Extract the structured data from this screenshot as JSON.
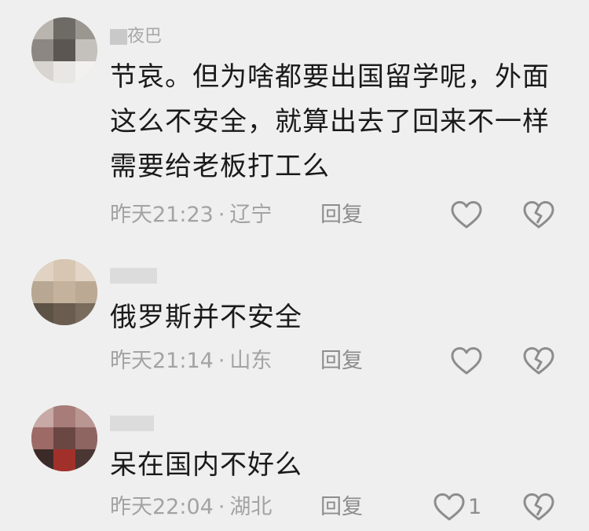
{
  "comments": [
    {
      "username": "夜巴",
      "text_lines": [
        "节哀。但为啥都要出国留学呢，外面",
        "这么不安全，就算出去了回来不一样",
        "需要给老板打工么"
      ],
      "time": "昨天21:23",
      "location": "辽宁",
      "reply_label": "回复",
      "like_count": "",
      "like_icon": "heart-outline-icon",
      "dislike_icon": "broken-heart-icon"
    },
    {
      "username": "",
      "text_lines": [
        "俄罗斯并不安全"
      ],
      "time": "昨天21:14",
      "location": "山东",
      "reply_label": "回复",
      "like_count": "",
      "like_icon": "heart-outline-icon",
      "dislike_icon": "broken-heart-icon"
    },
    {
      "username": "",
      "text_lines": [
        "呆在国内不好么"
      ],
      "time": "昨天22:04",
      "location": "湖北",
      "reply_label": "回复",
      "like_count": "1",
      "like_icon": "heart-outline-icon",
      "dislike_icon": "broken-heart-icon"
    }
  ],
  "separator": "·",
  "colors": {
    "background": "#efefef",
    "text": "#1a1a1a",
    "meta": "#a3a3a3",
    "icon": "#8d8d8d"
  }
}
